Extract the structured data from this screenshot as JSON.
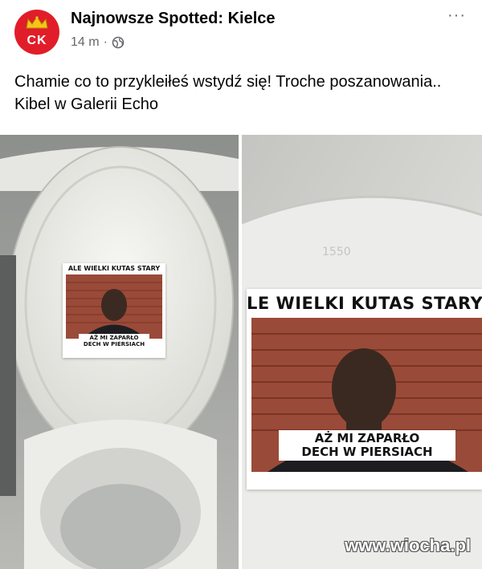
{
  "post": {
    "page_name": "Najnowsze Spotted: Kielce",
    "time": "14 m",
    "separator": "·",
    "avatar_text": "CK",
    "more_label": "···",
    "text": "Chamie co to przykleiłeś wstydź się! Troche poszanowania.. Kibel w Galerii Echo"
  },
  "photos": {
    "left": {
      "meme_top": "ALE WIELKI KUTAS STARY",
      "meme_bottom_line1": "AŻ MI ZAPARŁO",
      "meme_bottom_line2": "DECH W PIERSIACH"
    },
    "right": {
      "meme_top": "LE WIELKI KUTAS STARY",
      "meme_bottom_line1": "AŻ MI ZAPARŁO",
      "meme_bottom_line2": "DECH W PIERSIACH",
      "tile_text": "1550"
    }
  },
  "watermark": "www.wiocha.pl",
  "colors": {
    "avatar": "#e11d2a",
    "meta": "#65676b",
    "brick": "#9a4a38"
  }
}
